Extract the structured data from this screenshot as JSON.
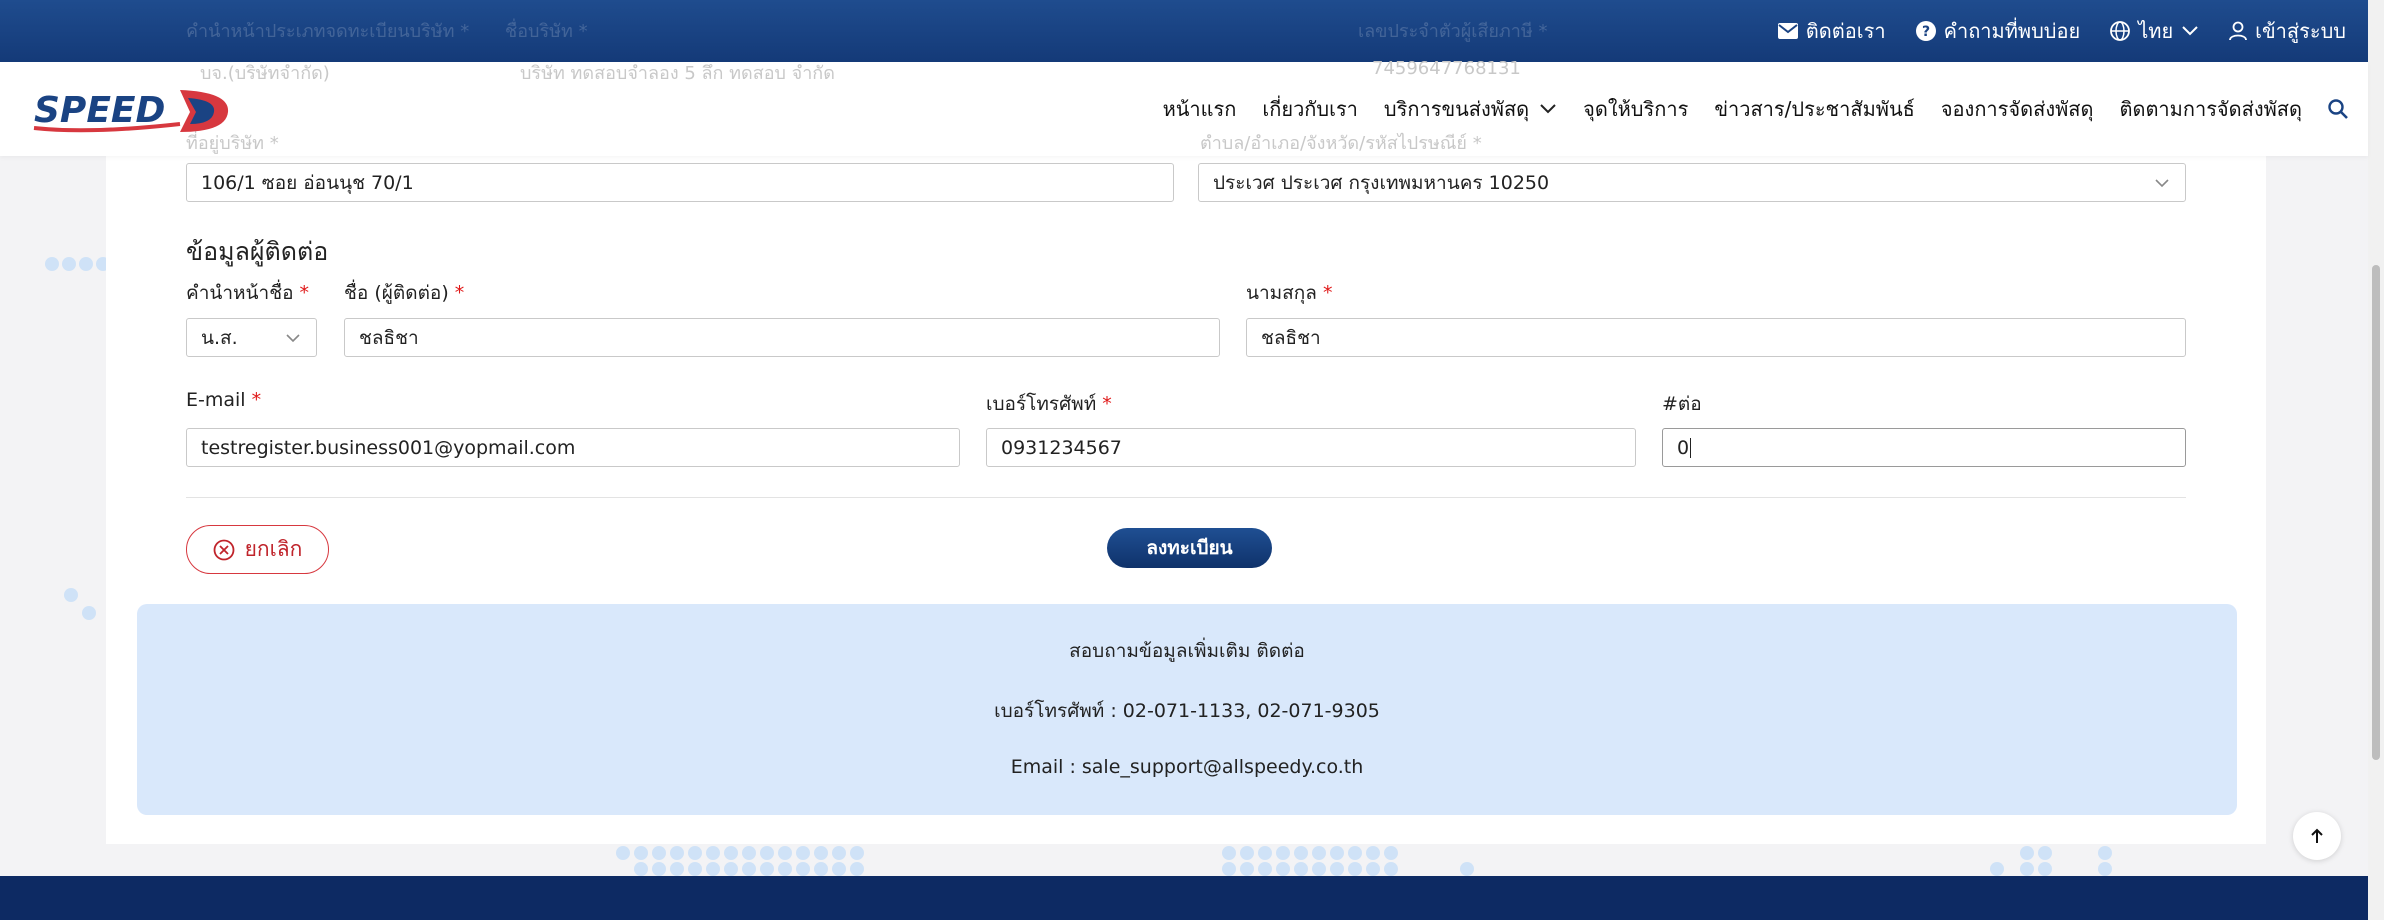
{
  "topbar": {
    "ghost_labels": [
      "คำนำหน้าประเภทจดทะเบียนบริษัท *",
      "ชื่อบริษัท *",
      "เลขประจำตัวผู้เสียภาษี *"
    ],
    "links": {
      "contact": "ติดต่อเรา",
      "faq": "คำถามที่พบบ่อย",
      "language": "ไทย",
      "login": "เข้าสู่ระบบ"
    }
  },
  "navbar": {
    "logo_text": "SPEED",
    "ghost_fields": [
      "บจ.(บริษัทจำกัด)",
      "บริษัท ทดสอบจำลอง 5 ลึก ทดสอบ จำกัด",
      "7459647768131"
    ],
    "ghost_labels": [
      "ที่อยู่บริษัท *",
      "ตำบล/อำเภอ/จังหวัด/รหัสไปรษณีย์ *"
    ],
    "items": [
      "หน้าแรก",
      "เกี่ยวกับเรา",
      "บริการขนส่งพัสดุ",
      "จุดให้บริการ",
      "ข่าวสาร/ประชาสัมพันธ์",
      "จองการจัดส่งพัสดุ",
      "ติดตามการจัดส่งพัสดุ"
    ]
  },
  "address": {
    "street_value": "106/1 ซอย อ่อนนุช 70/1",
    "district_value": "ประเวศ ประเวศ กรุงเทพมหานคร 10250"
  },
  "contact_section": {
    "title": "ข้อมูลผู้ติดต่อ",
    "prefix_label": "คำนำหน้าชื่อ",
    "prefix_value": "น.ส.",
    "firstname_label": "ชื่อ (ผู้ติดต่อ)",
    "firstname_value": "ชลธิชา",
    "lastname_label": "นามสกุล",
    "lastname_value": "ชลธิชา",
    "email_label": "E-mail",
    "email_value": "testregister.business001@yopmail.com",
    "phone_label": "เบอร์โทรศัพท์",
    "phone_value": "0931234567",
    "ext_label": "#ต่อ",
    "ext_value": "0",
    "required_mark": "*"
  },
  "actions": {
    "cancel": "ยกเลิก",
    "register": "ลงทะเบียน"
  },
  "info": {
    "line1": "สอบถามข้อมูลเพิ่มเติม ติดต่อ",
    "line2": "เบอร์โทรศัพท์ : 02-071-1133, 02-071-9305",
    "line3": "Email : sale_support@allspeedy.co.th"
  },
  "colors": {
    "brand_blue": "#143a78",
    "accent_red": "#d7383f",
    "info_bg": "#d9e8fb",
    "footer": "#0d2a63"
  }
}
